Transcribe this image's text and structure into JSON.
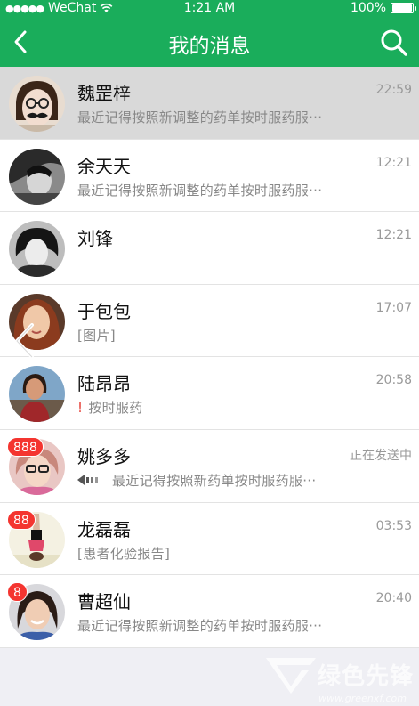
{
  "status": {
    "carrier": "WeChat",
    "time": "1:21 AM",
    "battery": "100%"
  },
  "nav": {
    "title": "我的消息"
  },
  "messages": [
    {
      "name": "魏罡梓",
      "time": "22:59",
      "preview": "最近记得按照新调整的药单按时服药服···",
      "badge": "",
      "selected": true,
      "avatar": "woman-glasses-mustache"
    },
    {
      "name": "余天天",
      "time": "12:21",
      "preview": "最近记得按照新调整的药单按时服药服···",
      "badge": "",
      "selected": false,
      "avatar": "bw-portrait"
    },
    {
      "name": "刘锋",
      "time": "12:21",
      "preview": "",
      "badge": "",
      "selected": false,
      "avatar": "bw-woman"
    },
    {
      "name": "于包包",
      "time": "17:07",
      "preview": "[图片]",
      "badge": "",
      "selected": false,
      "avatar": "woman-redhair"
    },
    {
      "name": "陆昂昂",
      "time": "20:58",
      "preview": "按时服药",
      "warn": "!",
      "badge": "",
      "selected": false,
      "avatar": "woman-outdoor"
    },
    {
      "name": "姚多多",
      "time": "正在发送中",
      "preview": "最近记得按照新药单按时服药服···",
      "badge": "888",
      "selected": false,
      "avatar": "woman-glasses-pink"
    },
    {
      "name": "龙磊磊",
      "time": "03:53",
      "preview": "[患者化验报告]",
      "badge": "88",
      "selected": false,
      "avatar": "yoga"
    },
    {
      "name": "曹超仙",
      "time": "20:40",
      "preview": "最近记得按照新调整的药单按时服药服···",
      "badge": "8",
      "selected": false,
      "avatar": "woman-smiling"
    }
  ],
  "watermark": {
    "text": "绿色先锋",
    "url": "www.greenxf.com"
  },
  "colors": {
    "brand": "#1aad5b",
    "badge": "#f43530"
  }
}
